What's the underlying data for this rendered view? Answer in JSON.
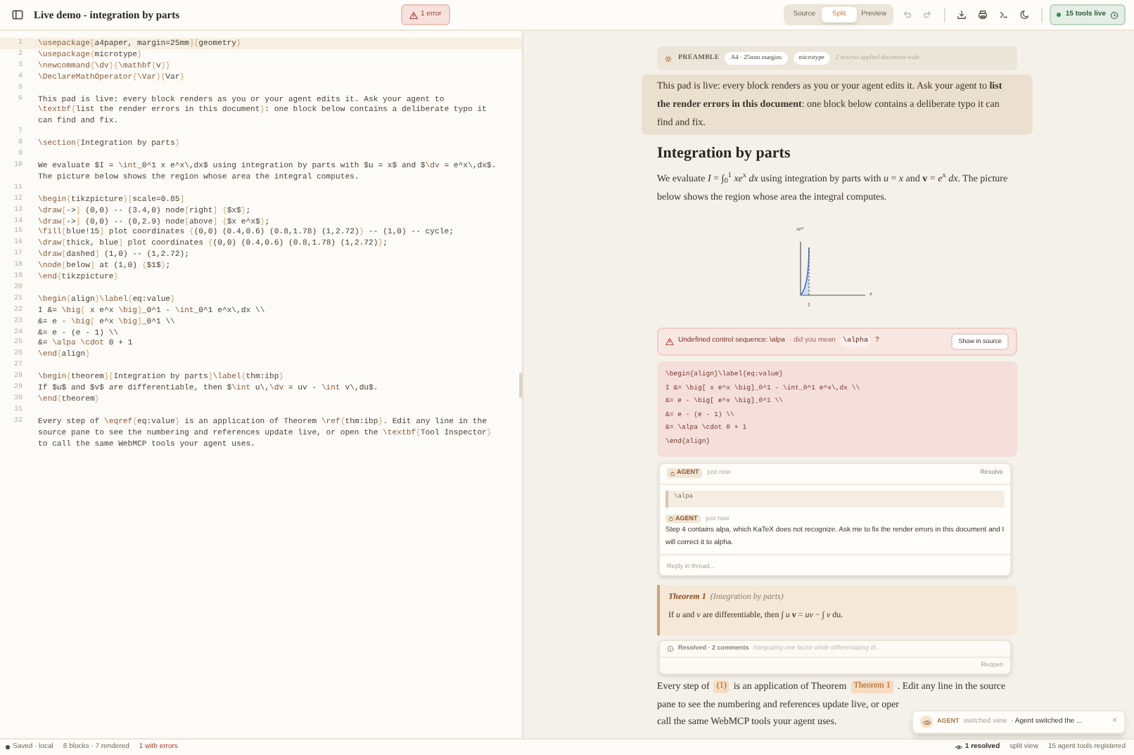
{
  "header": {
    "title": "Live demo - integration by parts",
    "error_badge": "1 error",
    "view_tabs": [
      {
        "label": "Source",
        "selected": false
      },
      {
        "label": "Split",
        "selected": true
      },
      {
        "label": "Preview",
        "selected": false
      }
    ],
    "tools_badge": "15 tools live"
  },
  "editor": {
    "lines": [
      {
        "number": "1",
        "text": "\\usepackage[a4paper, margin=25mm]{geometry}",
        "active": true
      },
      {
        "number": "2",
        "text": "\\usepackage{microtype}",
        "active": false
      },
      {
        "number": "3",
        "text": "\\newcommand{\\dv}{\\mathbf{v}}",
        "active": false
      },
      {
        "number": "4",
        "text": "\\DeclareMathOperator{\\Var}{Var}",
        "active": false
      },
      {
        "number": "5",
        "active": false
      },
      {
        "number": "6",
        "text": "This pad is live: every block renders as you or your agent edits it. Ask your agent to \\textbf{list the render errors in this document}: one block below contains a deliberate typo it can find and fix.",
        "active": false
      },
      {
        "number": "7",
        "active": false
      },
      {
        "number": "8",
        "text": "\\section{Integration by parts}",
        "active": false
      },
      {
        "number": "9",
        "active": false
      },
      {
        "number": "10",
        "text": "We evaluate $I = \\int_0^1 x e^x\\,dx$ using integration by parts with $u = x$ and $\\dv = e^x\\,dx$. The picture below shows the region whose area the integral computes.",
        "active": false
      },
      {
        "number": "11",
        "active": false
      },
      {
        "number": "12",
        "text": "\\begin{tikzpicture}[scale=0.85]",
        "active": false
      },
      {
        "number": "13",
        "text": "\\draw[->] (0,0) -- (3.4,0) node[right] {$x$};",
        "active": false
      },
      {
        "number": "14",
        "text": "\\draw[->] (0,0) -- (0,2.9) node[above] {$x e^x$};",
        "active": false
      },
      {
        "number": "15",
        "text": "\\fill[blue!15] plot coordinates {(0,0) (0.4,0.6) (0.8,1.78) (1,2.72)} -- (1,0) -- cycle;",
        "active": false
      },
      {
        "number": "16",
        "text": "\\draw[thick, blue] plot coordinates {(0,0) (0.4,0.6) (0.8,1.78) (1,2.72)};",
        "active": false
      },
      {
        "number": "17",
        "text": "\\draw[dashed] (1,0) -- (1,2.72);",
        "active": false
      },
      {
        "number": "18",
        "text": "\\node[below] at (1,0) {$1$};",
        "active": false
      },
      {
        "number": "19",
        "text": "\\end{tikzpicture}",
        "active": false
      },
      {
        "number": "20",
        "active": false
      },
      {
        "number": "21",
        "text": "\\begin{align}\\label{eq:value}",
        "active": false
      },
      {
        "number": "22",
        "text": "I &= \\big[ x e^x \\big]_0^1 - \\int_0^1 e^x\\,dx \\\\",
        "active": false
      },
      {
        "number": "23",
        "text": "&= e - \\big[ e^x \\big]_0^1 \\\\",
        "active": false
      },
      {
        "number": "24",
        "text": "&= e - (e - 1) \\\\",
        "active": false
      },
      {
        "number": "25",
        "text": "&= \\alpa \\cdot 0 + 1",
        "active": false
      },
      {
        "number": "26",
        "text": "\\end{align}",
        "active": false
      },
      {
        "number": "27",
        "active": false
      },
      {
        "number": "28",
        "text": "\\begin{theorem}[Integration by parts]\\label{thm:ibp}",
        "active": false
      },
      {
        "number": "29",
        "text": "If $u$ and $v$ are differentiable, then $\\int u\\,\\dv = uv - \\int v\\,du$.",
        "active": false
      },
      {
        "number": "30",
        "text": "\\end{theorem}",
        "active": false
      },
      {
        "number": "31",
        "active": false
      },
      {
        "number": "32",
        "text": "Every step of \\eqref{eq:value} is an application of Theorem \\ref{thm:ibp}. Edit any line in the source pane to see the numbering and references update live, or open the \\textbf{Tool Inspector} to call the same WebMCP tools your agent uses.",
        "active": false
      }
    ]
  },
  "preview": {
    "preamble": {
      "label": "PREAMBLE",
      "chips": [
        "A4 · 25mm margins",
        "microtype"
      ],
      "note": "2 macros applied document-wide"
    },
    "intro": {
      "text": "This pad is live: every block renders as you or your agent edits it. Ask your agent to **list the render errors in this document**: one block below contains a deliberate typo it can find and fix.",
      "highlighted": true
    },
    "heading": "Integration by parts",
    "paragraph": "We evaluate *I* = ∫$_{0}$$^{1}$ *xe*$^{x}$ *dx* using integration by parts with *u* = *x* and **v** = *e*$^{x}$ *dx*. The picture below shows the region whose area the integral computes.",
    "figure": {
      "y_label": "*xe*$^{x}$",
      "x_label": "*x*",
      "tick": "1"
    },
    "error": {
      "message": "Undefined control sequence: \\alpa",
      "hint": "· did you mean",
      "suggestion": "\\alpha",
      "hint_end": "?",
      "button": "Show in source"
    },
    "error_code": [
      "\\begin{align}\\label{eq:value}",
      "I &= \\big[ x e^x \\big]_0^1 - \\int_0^1 e^x\\,dx \\\\",
      "&= e - \\big[ e^x \\big]_0^1 \\\\",
      "&= e - (e - 1) \\\\",
      "&= \\alpa \\cdot 0 + 1",
      "\\end{align}"
    ],
    "thread": {
      "resolve": "Resolve",
      "comments": [
        {
          "author": "AGENT",
          "time": "just now",
          "quote": "\\alpa"
        },
        {
          "author": "AGENT",
          "time": "just now",
          "text": "Step 4 contains alpa, which KaTeX does not recognize. Ask me to fix the render errors in this document and I will correct it to alpha."
        }
      ],
      "reply_placeholder": "Reply in thread..."
    },
    "theorem": {
      "title": "Theorem 1",
      "note": "(Integration by parts)",
      "body": "If *u* and *v* are differentiable, then ∫ *u* **v** = *uv* − ∫ *v* du."
    },
    "resolved": {
      "summary": "Resolved · 2 comments",
      "excerpt": "Integrating one factor while differentiating th...",
      "button": "Reopen"
    },
    "closing": [
      [
        {
          "kind": "text",
          "text": "Every step of"
        },
        {
          "kind": "ref",
          "text": "(1)"
        },
        {
          "kind": "text",
          "text": "is an application of Theorem"
        },
        {
          "kind": "ref",
          "text": "Theorem 1"
        },
        {
          "kind": "text",
          "text": ". Edit any line in the source"
        }
      ],
      [
        {
          "kind": "text",
          "text": "pane to see the numbering and references update live, or oper"
        }
      ],
      [
        {
          "kind": "text",
          "text": "call the same WebMCP tools your agent uses."
        }
      ]
    ]
  },
  "toast": {
    "author": "AGENT",
    "action": "switched view",
    "message": "· Agent switched the ...",
    "close": "×"
  },
  "status_bar": {
    "saved": "Saved · local",
    "blocks": "8 blocks · 7 rendered",
    "errors": "1 with errors",
    "resolved": "1 resolved",
    "view": "split view",
    "tools": "15 agent tools registered"
  }
}
